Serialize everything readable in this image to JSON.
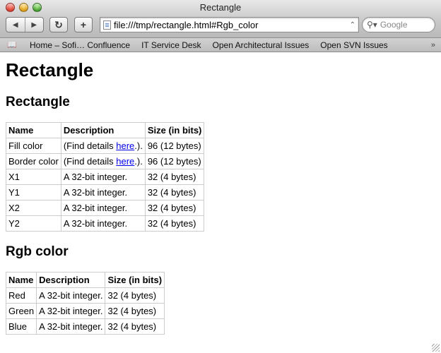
{
  "window": {
    "title": "Rectangle"
  },
  "toolbar": {
    "back_icon": "back-arrow-icon",
    "forward_icon": "forward-arrow-icon",
    "reload_icon": "reload-icon",
    "add_icon": "plus-icon",
    "address": "file:///tmp/rectangle.html#Rgb_color",
    "search_placeholder": "Google"
  },
  "bookmarks": [
    "Home – Sofi… Confluence",
    "IT Service Desk",
    "Open Architectural Issues",
    "Open SVN Issues"
  ],
  "page": {
    "h1": "Rectangle",
    "sections": [
      {
        "heading": "Rectangle",
        "columns": [
          "Name",
          "Description",
          "Size (in bits)"
        ],
        "rows": [
          {
            "name": "Fill color",
            "desc_pre": "(Find details ",
            "link": "here",
            "desc_post": ".).",
            "size": "96 (12 bytes)"
          },
          {
            "name": "Border color",
            "desc_pre": "(Find details ",
            "link": "here",
            "desc_post": ".).",
            "size": "96 (12 bytes)"
          },
          {
            "name": "X1",
            "desc": "A 32-bit integer.",
            "size": "32 (4 bytes)"
          },
          {
            "name": "Y1",
            "desc": "A 32-bit integer.",
            "size": "32 (4 bytes)"
          },
          {
            "name": "X2",
            "desc": "A 32-bit integer.",
            "size": "32 (4 bytes)"
          },
          {
            "name": "Y2",
            "desc": "A 32-bit integer.",
            "size": "32 (4 bytes)"
          }
        ]
      },
      {
        "heading": "Rgb color",
        "columns": [
          "Name",
          "Description",
          "Size (in bits)"
        ],
        "rows": [
          {
            "name": "Red",
            "desc": "A 32-bit integer.",
            "size": "32 (4 bytes)"
          },
          {
            "name": "Green",
            "desc": "A 32-bit integer.",
            "size": "32 (4 bytes)"
          },
          {
            "name": "Blue",
            "desc": "A 32-bit integer.",
            "size": "32 (4 bytes)"
          }
        ]
      }
    ]
  }
}
